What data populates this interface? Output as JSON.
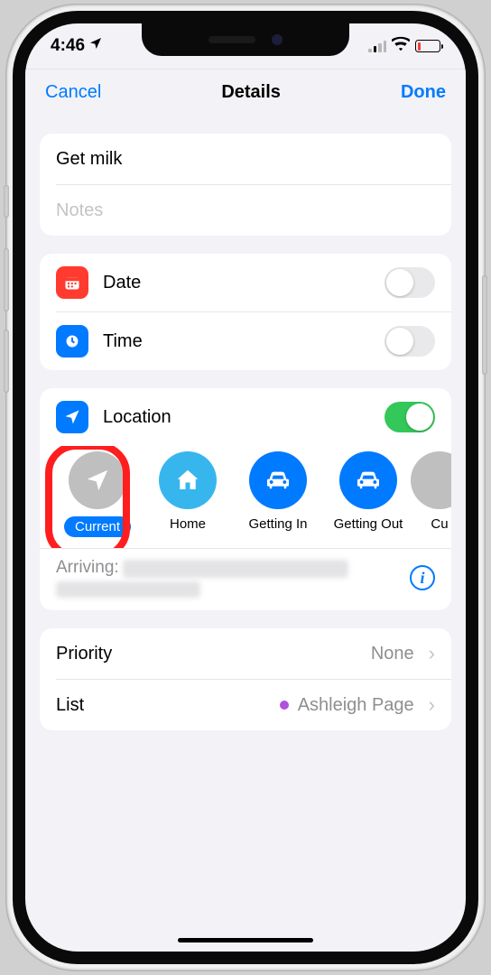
{
  "status": {
    "time": "4:46",
    "location_services": true
  },
  "nav": {
    "cancel": "Cancel",
    "title": "Details",
    "done": "Done"
  },
  "reminder": {
    "title": "Get milk",
    "notes_placeholder": "Notes"
  },
  "rows": {
    "date": {
      "label": "Date",
      "on": false
    },
    "time": {
      "label": "Time",
      "on": false
    },
    "location": {
      "label": "Location",
      "on": true
    }
  },
  "location_options": [
    {
      "key": "current",
      "label": "Current",
      "icon": "arrow",
      "selected": true
    },
    {
      "key": "home",
      "label": "Home",
      "icon": "house"
    },
    {
      "key": "getting_in",
      "label": "Getting In",
      "icon": "car"
    },
    {
      "key": "getting_out",
      "label": "Getting Out",
      "icon": "car"
    },
    {
      "key": "custom",
      "label": "Cu",
      "icon": "arrow",
      "partial": true
    }
  ],
  "arriving": {
    "prefix": "Arriving:",
    "address_redacted": true
  },
  "priority": {
    "label": "Priority",
    "value": "None"
  },
  "list": {
    "label": "List",
    "value": "Ashleigh Page",
    "color": "#af52de"
  },
  "colors": {
    "tint": "#007aff",
    "green": "#34c759",
    "red": "#ff3b30",
    "purple": "#af52de"
  },
  "annotation": {
    "highlight": "current"
  }
}
